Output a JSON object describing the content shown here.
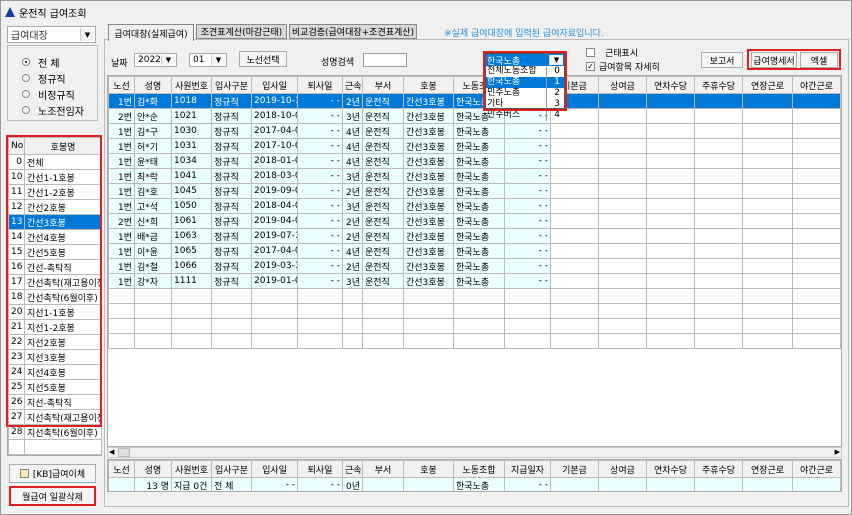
{
  "window": {
    "title": "운전직 급여조회"
  },
  "left": {
    "ledger_select": "급여대장",
    "radios": [
      {
        "label": "전 체",
        "checked": true
      },
      {
        "label": "정규직",
        "checked": false
      },
      {
        "label": "비정규직",
        "checked": false
      },
      {
        "label": "노조전임자",
        "checked": false
      }
    ],
    "list_headers": [
      "No",
      "호봉명"
    ],
    "list": [
      [
        "0",
        "전체"
      ],
      [
        "10",
        "간선1-1호봉"
      ],
      [
        "11",
        "간선1-2호봉"
      ],
      [
        "12",
        "간선2호봉"
      ],
      [
        "13",
        "간선3호봉"
      ],
      [
        "14",
        "간선4호봉"
      ],
      [
        "15",
        "간선5호봉"
      ],
      [
        "16",
        "간선-촉탁직"
      ],
      [
        "17",
        "간선촉탁(재고용이전)"
      ],
      [
        "18",
        "간선촉탁(6월이후)"
      ],
      [
        "20",
        "지선1-1호봉"
      ],
      [
        "21",
        "지선1-2호봉"
      ],
      [
        "22",
        "지선2호봉"
      ],
      [
        "23",
        "지선3호봉"
      ],
      [
        "24",
        "지선4호봉"
      ],
      [
        "25",
        "지선5호봉"
      ],
      [
        "26",
        "지선-촉탁직"
      ],
      [
        "27",
        "지선촉탁(재고용이전)"
      ],
      [
        "28",
        "지선촉탁(6월이후)"
      ]
    ],
    "selected_no": "13",
    "kb_button": "[KB]급여이체",
    "delete_button": "월급여 일괄삭제"
  },
  "tabs": [
    {
      "label": "급여대장(실제급여)",
      "active": true
    },
    {
      "label": "조견표계산(마감근태)"
    },
    {
      "label": "비교검증(급여대장+조견표계산)"
    }
  ],
  "notice": "※실제 급여대장에 입력된 급여자료입니다.",
  "filters": {
    "date_label": "날짜",
    "year": "2022",
    "month": "01",
    "route_button": "노선선택",
    "name_search_label": "성명검색",
    "name_search_value": "",
    "union_select": "한국노총",
    "union_options": [
      [
        "전체노동조합",
        "0"
      ],
      [
        "한국노총",
        "1"
      ],
      [
        "민주노총",
        "2"
      ],
      [
        "기타",
        "3"
      ],
      [
        "민주버스",
        "4"
      ]
    ],
    "attendance_label": "근태표시",
    "attendance_checked": false,
    "detail_label": "급여항목 자세히",
    "detail_checked": true,
    "report_button": "보고서",
    "payslip_button": "급여명세서",
    "excel_button": "엑셀"
  },
  "grid": {
    "headers": [
      "노선",
      "성명",
      "사원번호",
      "입사구분",
      "입사일",
      "퇴사일",
      "근속",
      "부서",
      "호봉",
      "노동조합",
      "지급일자",
      "기본금",
      "상여금",
      "연차수당",
      "주휴수당",
      "연장근로",
      "야간근로"
    ],
    "rows": [
      [
        "1번",
        "김*화",
        "1018",
        "정규직",
        "2019-10-15",
        "- -",
        "2년",
        "운전직",
        "간선3호봉",
        "한국노총",
        "- -"
      ],
      [
        "2번",
        "안*순",
        "1021",
        "정규직",
        "2018-10-01",
        "- -",
        "3년",
        "운전직",
        "간선3호봉",
        "한국노총",
        "- -"
      ],
      [
        "1번",
        "김*구",
        "1030",
        "정규직",
        "2017-04-01",
        "- -",
        "4년",
        "운전직",
        "간선3호봉",
        "한국노총",
        "- -"
      ],
      [
        "1번",
        "허*기",
        "1031",
        "정규직",
        "2017-10-01",
        "- -",
        "4년",
        "운전직",
        "간선3호봉",
        "한국노총",
        "- -"
      ],
      [
        "1번",
        "윤*태",
        "1034",
        "정규직",
        "2018-01-01",
        "- -",
        "4년",
        "운전직",
        "간선3호봉",
        "한국노총",
        "- -"
      ],
      [
        "1번",
        "최*락",
        "1041",
        "정규직",
        "2018-03-01",
        "- -",
        "3년",
        "운전직",
        "간선3호봉",
        "한국노총",
        "- -"
      ],
      [
        "1번",
        "김*호",
        "1045",
        "정규직",
        "2019-09-01",
        "- -",
        "2년",
        "운전직",
        "간선3호봉",
        "한국노총",
        "- -"
      ],
      [
        "1번",
        "고*석",
        "1050",
        "정규직",
        "2018-04-01",
        "- -",
        "3년",
        "운전직",
        "간선3호봉",
        "한국노총",
        "- -"
      ],
      [
        "2번",
        "신*희",
        "1061",
        "정규직",
        "2019-04-01",
        "- -",
        "2년",
        "운전직",
        "간선3호봉",
        "한국노총",
        "- -"
      ],
      [
        "1번",
        "배*금",
        "1063",
        "정규직",
        "2019-07-15",
        "- -",
        "2년",
        "운전직",
        "간선3호봉",
        "한국노총",
        "- -"
      ],
      [
        "1번",
        "이*윤",
        "1065",
        "정규직",
        "2017-04-01",
        "- -",
        "4년",
        "운전직",
        "간선3호봉",
        "한국노총",
        "- -"
      ],
      [
        "1번",
        "김*철",
        "1066",
        "정규직",
        "2019-03-18",
        "- -",
        "2년",
        "운전직",
        "간선3호봉",
        "한국노총",
        "- -"
      ],
      [
        "1번",
        "강*자",
        "1111",
        "정규직",
        "2019-01-01",
        "- -",
        "3년",
        "운전직",
        "간선3호봉",
        "한국노총",
        "- -"
      ]
    ],
    "summary": [
      "",
      "13 명",
      "지급 0건",
      "전 체",
      "- -",
      "- -",
      "0년",
      "",
      "",
      "한국노총",
      "- -",
      "",
      "",
      "",
      "",
      "",
      ""
    ]
  }
}
